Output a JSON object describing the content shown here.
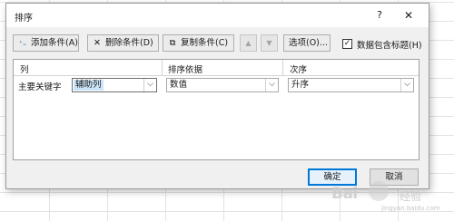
{
  "dialog": {
    "title": "排序",
    "help_label": "?",
    "close_label": "✕"
  },
  "toolbar": {
    "add_level": {
      "icon": "add-level-icon",
      "glyph": "⁺₌",
      "label": "添加条件(A)"
    },
    "delete_level": {
      "icon": "delete-level-icon",
      "glyph": "✕",
      "label": "删除条件(D)"
    },
    "copy_level": {
      "icon": "copy-level-icon",
      "glyph": "⧉",
      "label": "复制条件(C)"
    },
    "move_up": {
      "glyph": "▲"
    },
    "move_down": {
      "glyph": "▼"
    },
    "options_label": "选项(O)...",
    "header_checkbox_label": "数据包含标题(H)",
    "header_checkbox_checked": "✓"
  },
  "grid": {
    "col_column": "列",
    "col_sort_on": "排序依据",
    "col_order": "次序",
    "rows": [
      {
        "label": "主要关键字",
        "column": "辅助列",
        "sort_on": "数值",
        "order": "升序"
      }
    ],
    "dropdown_glyph": "⌵"
  },
  "buttons": {
    "ok": "确定",
    "cancel": "取消"
  },
  "watermark": {
    "brand": "Bai",
    "brand2": "经验",
    "url": "jingyan.baidu.com"
  }
}
